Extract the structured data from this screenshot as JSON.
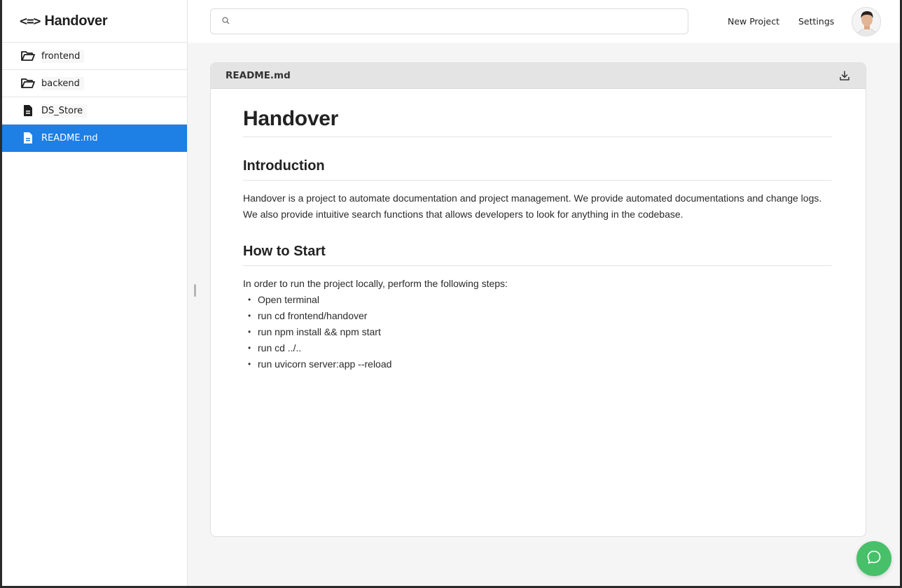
{
  "brand": {
    "logo_glyph": "<=>",
    "name": "Handover"
  },
  "sidebar": {
    "items": [
      {
        "label": "frontend",
        "icon": "folder-open-icon"
      },
      {
        "label": "backend",
        "icon": "folder-open-icon"
      },
      {
        "label": "DS_Store",
        "icon": "file-icon"
      },
      {
        "label": "README.md",
        "icon": "file-icon",
        "active": true
      }
    ]
  },
  "search": {
    "placeholder": "",
    "value": ""
  },
  "header": {
    "new_project": "New Project",
    "settings": "Settings"
  },
  "document": {
    "filename": "README.md",
    "title": "Handover",
    "sections": [
      {
        "heading": "Introduction",
        "paragraph": "Handover is a project to automate documentation and project management. We provide automated documentations and change logs. We also provide intuitive search functions that allows developers to look for anything in the codebase."
      },
      {
        "heading": "How to Start",
        "paragraph": "In order to run the project locally, perform the following steps:",
        "steps": [
          "Open terminal",
          "run cd frontend/handover",
          "run npm install && npm start",
          "run cd ../..",
          "run uvicorn server:app --reload"
        ]
      }
    ]
  },
  "colors": {
    "accent": "#1e7fe5",
    "chat_button": "#48c06a",
    "card_header": "#e4e4e4"
  }
}
